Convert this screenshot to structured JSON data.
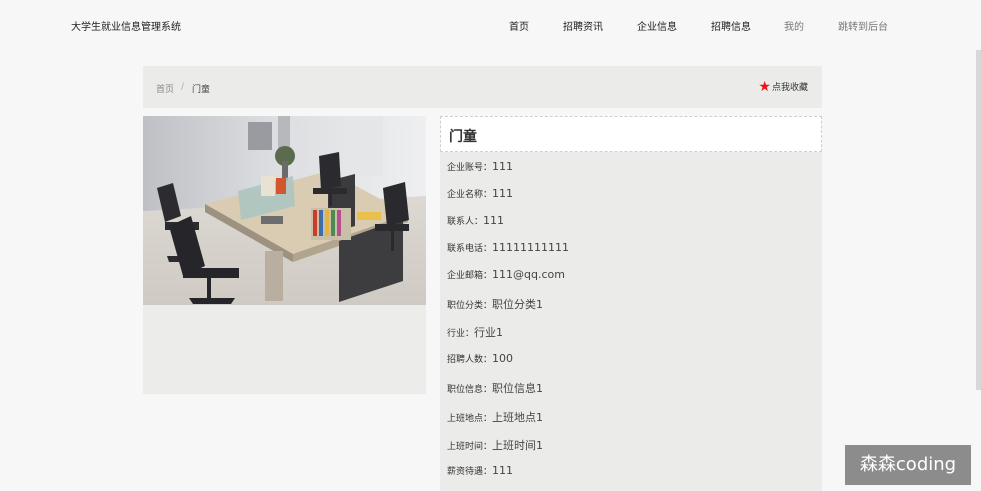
{
  "header": {
    "brand": "大学生就业信息管理系统",
    "nav": [
      "首页",
      "招聘资讯",
      "企业信息",
      "招聘信息",
      "我的",
      "跳转到后台"
    ]
  },
  "breadcrumb": {
    "home": "首页",
    "sep": "/",
    "current": "门童"
  },
  "favorite": {
    "label": "点我收藏"
  },
  "detail": {
    "title": "门童",
    "fields": [
      {
        "label": "企业账号：",
        "value": "111"
      },
      {
        "label": "企业名称：",
        "value": "111"
      },
      {
        "label": "联系人：",
        "value": "111"
      },
      {
        "label": "联系电话：",
        "value": "11111111111"
      },
      {
        "label": "企业邮箱：",
        "value": "111@qq.com"
      },
      {
        "label": "职位分类：",
        "value": "职位分类1"
      },
      {
        "label": "行业：",
        "value": "行业1"
      },
      {
        "label": "招聘人数：",
        "value": "100"
      },
      {
        "label": "职位信息：",
        "value": "职位信息1"
      },
      {
        "label": "上班地点：",
        "value": "上班地点1"
      },
      {
        "label": "上班时间：",
        "value": "上班时间1"
      },
      {
        "label": "薪资待遇：",
        "value": "111"
      }
    ]
  },
  "watermark": "森森coding",
  "colors": {
    "star": "#e8151b",
    "panel": "#ebebea",
    "background": "#f7f7f7"
  }
}
